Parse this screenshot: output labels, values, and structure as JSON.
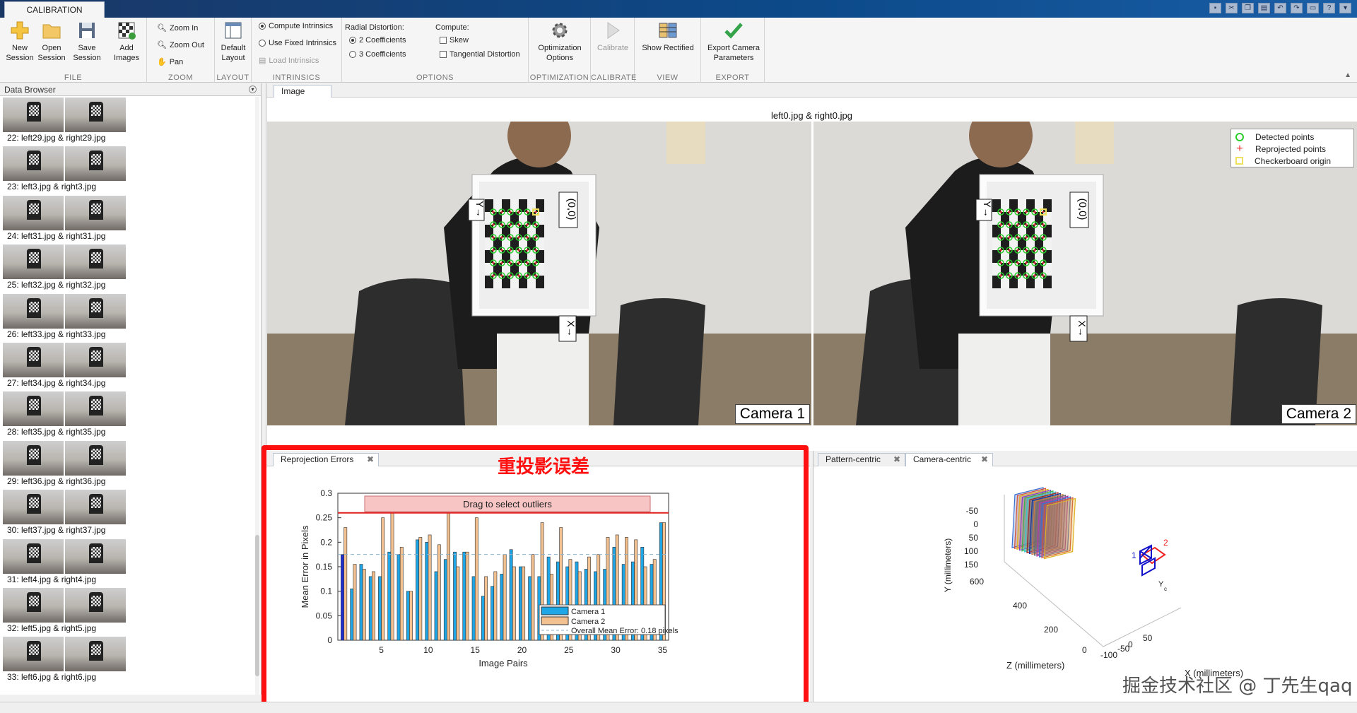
{
  "app": {
    "tab": "CALIBRATION"
  },
  "ribbon": {
    "file": {
      "label": "FILE",
      "new_session": "New Session",
      "open_session": "Open Session",
      "save_session": "Save Session",
      "add_images": "Add Images"
    },
    "zoom": {
      "label": "ZOOM",
      "zoom_in": "Zoom In",
      "zoom_out": "Zoom Out",
      "pan": "Pan"
    },
    "layout": {
      "label": "LAYOUT",
      "default_layout": "Default Layout"
    },
    "intrinsics": {
      "label": "INTRINSICS",
      "compute": "Compute Intrinsics",
      "fixed": "Use Fixed Intrinsics",
      "load": "Load Intrinsics"
    },
    "options": {
      "label": "OPTIONS",
      "radial": "Radial Distortion:",
      "two_coef": "2 Coefficients",
      "three_coef": "3 Coefficients",
      "compute": "Compute:",
      "skew": "Skew",
      "tangential": "Tangential Distortion"
    },
    "optimization": {
      "label": "OPTIMIZATION",
      "button": "Optimization Options"
    },
    "calibrate": {
      "label": "CALIBRATE",
      "button": "Calibrate"
    },
    "view": {
      "label": "VIEW",
      "button": "Show Rectified"
    },
    "export": {
      "label": "EXPORT",
      "button": "Export Camera Parameters"
    }
  },
  "data_browser": {
    "title": "Data Browser",
    "items": [
      "22: left29.jpg & right29.jpg",
      "23: left3.jpg & right3.jpg",
      "24: left31.jpg & right31.jpg",
      "25: left32.jpg & right32.jpg",
      "26: left33.jpg & right33.jpg",
      "27: left34.jpg & right34.jpg",
      "28: left35.jpg & right35.jpg",
      "29: left36.jpg & right36.jpg",
      "30: left37.jpg & right37.jpg",
      "31: left4.jpg & right4.jpg",
      "32: left5.jpg & right5.jpg",
      "33: left6.jpg & right6.jpg"
    ]
  },
  "image_panel": {
    "tab": "Image",
    "title": "left0.jpg & right0.jpg",
    "camera1": "Camera 1",
    "camera2": "Camera 2",
    "overlay": {
      "y_label": "Y→",
      "origin": "(0,0)",
      "x_label": "X→"
    },
    "legend": [
      "Detected points",
      "Reprojected points",
      "Checkerboard origin"
    ],
    "colors": {
      "detected": "#2dcc2d",
      "reprojected": "#e22222",
      "origin": "#f0e060"
    }
  },
  "reprojection": {
    "tab": "Reprojection Errors",
    "annotation": "重投影误差",
    "drag_text": "Drag to select outliers",
    "legend": {
      "cam1": "Camera 1",
      "cam2": "Camera 2",
      "mean": "Overall Mean Error: 0.18 pixels"
    }
  },
  "chart_data": {
    "type": "bar",
    "xlabel": "Image Pairs",
    "ylabel": "Mean Error in Pixels",
    "ylim": [
      0,
      0.3
    ],
    "yticks": [
      "0",
      "0.05",
      "0.1",
      "0.15",
      "0.2",
      "0.25",
      "0.3"
    ],
    "xticks": [
      "5",
      "10",
      "15",
      "20",
      "25",
      "30",
      "35"
    ],
    "categories": [
      1,
      2,
      3,
      4,
      5,
      6,
      7,
      8,
      9,
      10,
      11,
      12,
      13,
      14,
      15,
      16,
      17,
      18,
      19,
      20,
      21,
      22,
      23,
      24,
      25,
      26,
      27,
      28,
      29,
      30,
      31,
      32,
      33,
      34,
      35
    ],
    "mean": 0.175,
    "outlier_threshold": 0.26,
    "series": [
      {
        "name": "Camera 1",
        "color": "#1ea6e6",
        "values": [
          0.175,
          0.105,
          0.155,
          0.13,
          0.13,
          0.18,
          0.175,
          0.1,
          0.205,
          0.2,
          0.14,
          0.165,
          0.18,
          0.18,
          0.13,
          0.09,
          0.11,
          0.135,
          0.185,
          0.15,
          0.13,
          0.13,
          0.17,
          0.16,
          0.15,
          0.16,
          0.145,
          0.14,
          0.145,
          0.19,
          0.155,
          0.16,
          0.19,
          0.155,
          0.24
        ]
      },
      {
        "name": "Camera 2",
        "color": "#f3c08f",
        "values": [
          0.23,
          0.155,
          0.145,
          0.14,
          0.25,
          0.26,
          0.19,
          0.1,
          0.21,
          0.215,
          0.195,
          0.26,
          0.15,
          0.18,
          0.25,
          0.13,
          0.14,
          0.175,
          0.15,
          0.15,
          0.175,
          0.24,
          0.135,
          0.23,
          0.165,
          0.14,
          0.17,
          0.175,
          0.21,
          0.215,
          0.21,
          0.205,
          0.15,
          0.165,
          0.24
        ]
      }
    ]
  },
  "camera_centric": {
    "tabs": [
      "Pattern-centric",
      "Camera-centric"
    ],
    "y_label": "Y (millimeters)",
    "z_label": "Z (millimeters)",
    "x_label": "X (millimeters)",
    "y_ticks": [
      "-50",
      "0",
      "50",
      "100",
      "150"
    ],
    "z_ticks": [
      "600",
      "400",
      "200",
      "0"
    ],
    "x_ticks": [
      "-100",
      "-50",
      "0",
      "50"
    ],
    "cam_labels": [
      "1",
      "2"
    ],
    "origin_label": "Y",
    "origin_sub": "c"
  },
  "watermark": "掘金技术社区 @ 丁先生qaq"
}
